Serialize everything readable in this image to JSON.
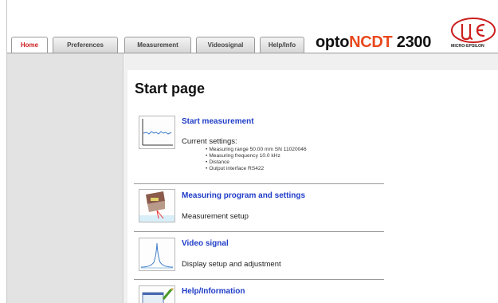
{
  "tabs": [
    {
      "label": "Home",
      "active": true
    },
    {
      "label": "Preferences",
      "active": false
    },
    {
      "label": "Measurement",
      "active": false
    },
    {
      "label": "Videosignal",
      "active": false
    },
    {
      "label": "Help/Info",
      "active": false
    }
  ],
  "brand": {
    "prefix": "opto",
    "highlight": "NCDT",
    "suffix": " 2300"
  },
  "logo": {
    "text": "MICRO-EPSILON",
    "color": "#cc1f1f"
  },
  "page": {
    "title": "Start page"
  },
  "entries": [
    {
      "title": "Start measurement",
      "desc": "Current settings:",
      "icon": "measurement-graph-icon",
      "settings": [
        "Measuring range 50.00 mm SN 11020046",
        "Measuring frequency 10.0 kHz",
        "Distance",
        "Output interface RS422"
      ]
    },
    {
      "title": "Measuring program and settings",
      "desc": "Measurement setup",
      "icon": "sensor-laser-icon"
    },
    {
      "title": "Video signal",
      "desc": "Display setup and adjustment",
      "icon": "video-signal-peak-icon"
    },
    {
      "title": "Help/Information",
      "icon": "help-info-icon"
    }
  ],
  "colors": {
    "active_tab": "#cc2020",
    "link": "#1f3cc8",
    "brand_accent": "#e8491d"
  }
}
